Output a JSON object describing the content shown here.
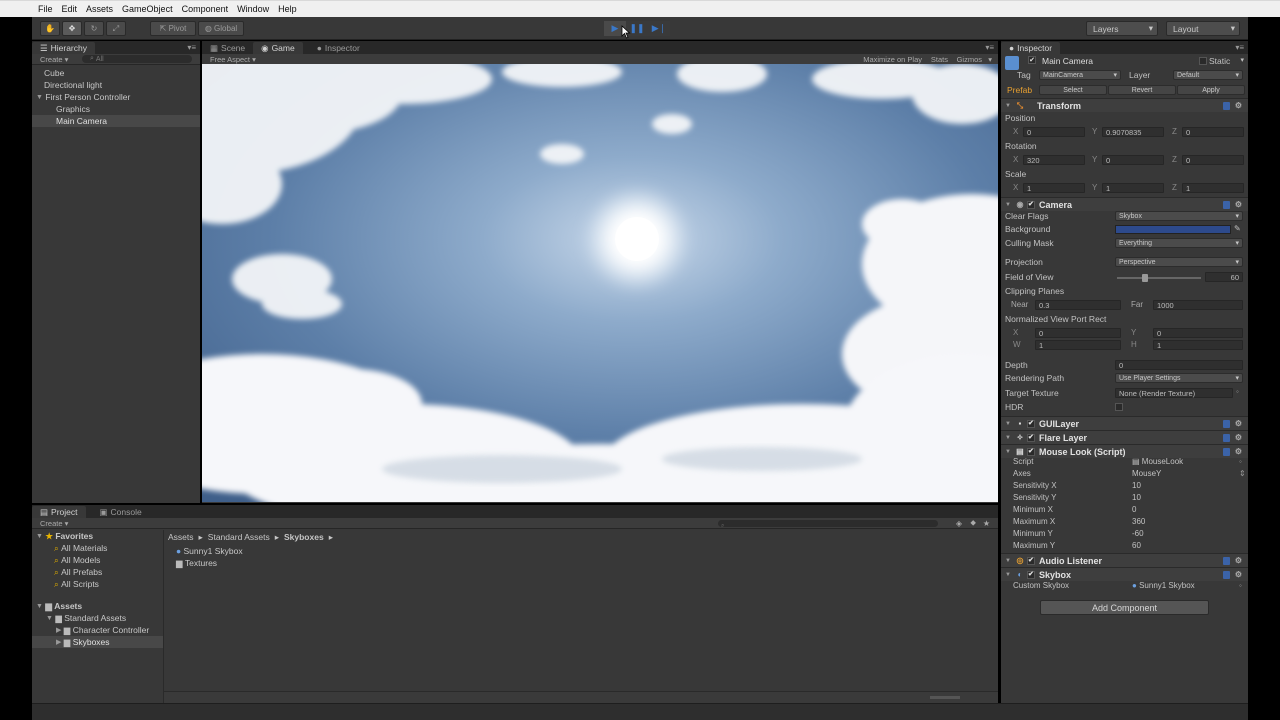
{
  "menu": [
    "File",
    "Edit",
    "Assets",
    "GameObject",
    "Component",
    "Window",
    "Help"
  ],
  "toolbar": {
    "pivot": "Pivot",
    "global": "Global",
    "layers": "Layers",
    "layout": "Layout"
  },
  "hierarchy": {
    "tab": "Hierarchy",
    "create": "Create",
    "search_placeholder": "All",
    "items": [
      "Cube",
      "Directional light",
      "First Person Controller",
      "Graphics",
      "Main Camera"
    ]
  },
  "center_tabs": {
    "scene": "Scene",
    "game": "Game",
    "inspector": "Inspector"
  },
  "game_bar": {
    "aspect": "Free Aspect",
    "maximize": "Maximize on Play",
    "stats": "Stats",
    "gizmos": "Gizmos"
  },
  "project": {
    "tab": "Project",
    "console_tab": "Console",
    "create": "Create",
    "favorites_label": "Favorites",
    "favorites": [
      "All Materials",
      "All Models",
      "All Prefabs",
      "All Scripts"
    ],
    "assets_label": "Assets",
    "assets_tree": [
      "Standard Assets",
      "Character Controller",
      "Skyboxes"
    ],
    "breadcrumb": [
      "Assets",
      "Standard Assets",
      "Skyboxes"
    ],
    "files": [
      "Sunny1 Skybox",
      "Textures"
    ]
  },
  "inspector": {
    "tab": "Inspector",
    "object_name": "Main Camera",
    "static_label": "Static",
    "tag_label": "Tag",
    "tag_value": "MainCamera",
    "layer_label": "Layer",
    "layer_value": "Default",
    "prefab_label": "Prefab",
    "prefab_select": "Select",
    "prefab_revert": "Revert",
    "prefab_apply": "Apply",
    "transform": {
      "title": "Transform",
      "position_label": "Position",
      "position": {
        "x": "0",
        "y": "0.9070835",
        "z": "0"
      },
      "rotation_label": "Rotation",
      "rotation": {
        "x": "320",
        "y": "0",
        "z": "0"
      },
      "scale_label": "Scale",
      "scale": {
        "x": "1",
        "y": "1",
        "z": "1"
      }
    },
    "camera": {
      "title": "Camera",
      "clear_flags_label": "Clear Flags",
      "clear_flags": "Skybox",
      "background_label": "Background",
      "background_color": "#2d4a8c",
      "culling_mask_label": "Culling Mask",
      "culling_mask": "Everything",
      "projection_label": "Projection",
      "projection": "Perspective",
      "fov_label": "Field of View",
      "fov": "60",
      "fov_fraction": 0.33,
      "clipping_label": "Clipping Planes",
      "near_label": "Near",
      "near": "0.3",
      "far_label": "Far",
      "far": "1000",
      "viewport_label": "Normalized View Port Rect",
      "vp_x": "0",
      "vp_y": "0",
      "vp_w": "1",
      "vp_h": "1",
      "depth_label": "Depth",
      "depth": "0",
      "rendering_path_label": "Rendering Path",
      "rendering_path": "Use Player Settings",
      "target_texture_label": "Target Texture",
      "target_texture": "None (Render Texture)",
      "hdr_label": "HDR"
    },
    "gui_layer": "GUILayer",
    "flare_layer": "Flare Layer",
    "mouse_look": {
      "title": "Mouse Look (Script)",
      "script_label": "Script",
      "script": "MouseLook",
      "axes_label": "Axes",
      "axes": "MouseY",
      "sens_x_label": "Sensitivity X",
      "sens_x": "10",
      "sens_y_label": "Sensitivity Y",
      "sens_y": "10",
      "min_x_label": "Minimum X",
      "min_x": "0",
      "max_x_label": "Maximum X",
      "max_x": "360",
      "min_y_label": "Minimum Y",
      "min_y": "-60",
      "max_y_label": "Maximum Y",
      "max_y": "60"
    },
    "audio_listener": "Audio Listener",
    "skybox": {
      "title": "Skybox",
      "custom_label": "Custom Skybox",
      "custom_value": "Sunny1 Skybox"
    },
    "add_component": "Add Component"
  }
}
